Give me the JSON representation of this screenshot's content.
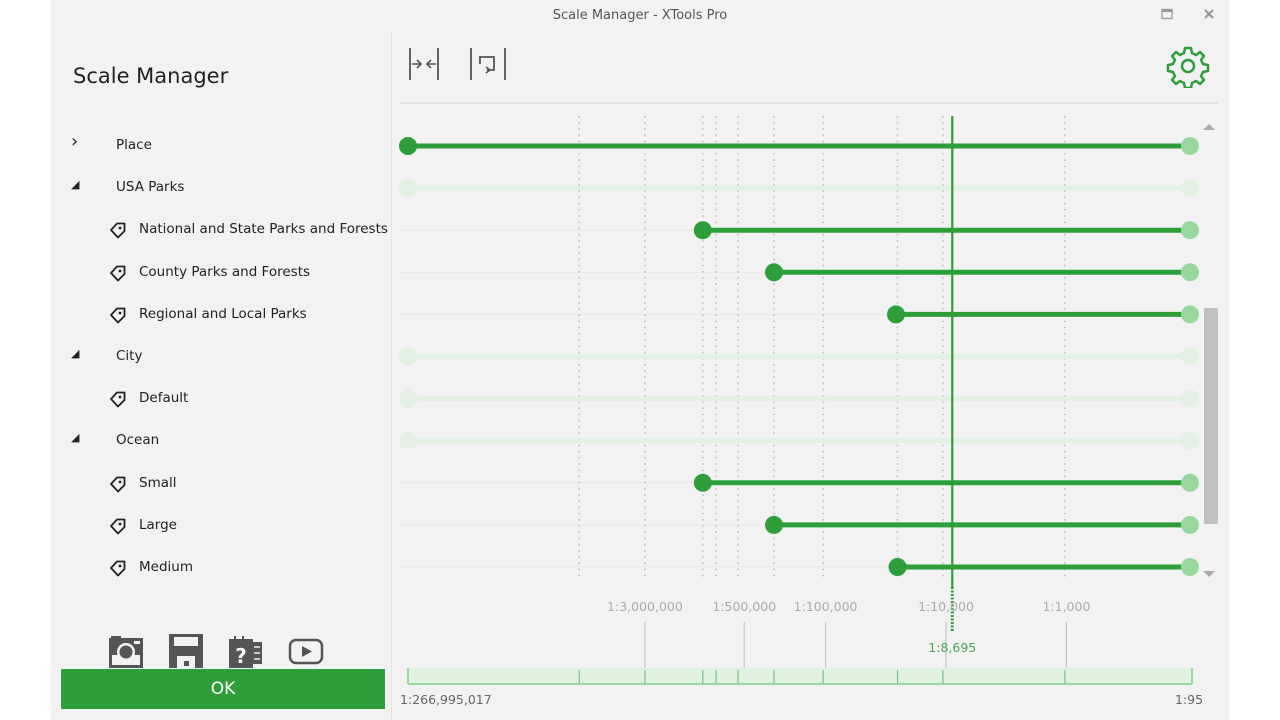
{
  "window": {
    "title": "Scale Manager  -  XTools Pro",
    "maximize_icon": "maximize-icon",
    "close_icon": "close-icon"
  },
  "sidebar": {
    "title": "Scale Manager",
    "tree": [
      {
        "label": "Place",
        "type": "group",
        "expanded": false,
        "active": true,
        "min_scale": "1:266,995,017",
        "max_scale": "1:95"
      },
      {
        "label": "USA Parks",
        "type": "group",
        "expanded": true,
        "active": false
      },
      {
        "label": "National and State Parks and Forests",
        "type": "label-class",
        "active": true,
        "min_scale": "1:1,000,000"
      },
      {
        "label": "County Parks and Forests",
        "type": "label-class",
        "active": true,
        "min_scale": "1:250,000"
      },
      {
        "label": "Regional and Local Parks",
        "type": "label-class",
        "active": true,
        "min_scale": "1:25,000"
      },
      {
        "label": "City",
        "type": "group",
        "expanded": true,
        "active": false
      },
      {
        "label": "Default",
        "type": "label-class",
        "active": false
      },
      {
        "label": "Ocean",
        "type": "group",
        "expanded": true,
        "active": false
      },
      {
        "label": "Small",
        "type": "label-class",
        "active": true,
        "min_scale": "1:1,000,000"
      },
      {
        "label": "Large",
        "type": "label-class",
        "active": true,
        "min_scale": "1:250,000"
      },
      {
        "label": "Medium",
        "type": "label-class",
        "active": true,
        "min_scale": "1:25,000"
      }
    ],
    "tools": [
      {
        "name": "screenshot",
        "icon": "camera-icon"
      },
      {
        "name": "save",
        "icon": "save-icon"
      },
      {
        "name": "help",
        "icon": "help-notebook-icon"
      },
      {
        "name": "video",
        "icon": "video-play-icon"
      }
    ],
    "ok_label": "OK"
  },
  "toolbar": {
    "fit_icon": "fit-width-icon",
    "reset_icon": "reset-range-icon",
    "settings_icon": "gear-icon"
  },
  "scale_axis": {
    "labels": [
      {
        "text": "1:3,000,000",
        "pos": 0.303
      },
      {
        "text": "1:500,000",
        "pos": 0.43
      },
      {
        "text": "1:100,000",
        "pos": 0.534
      },
      {
        "text": "1:10,000",
        "pos": 0.688
      },
      {
        "text": "1:1,000",
        "pos": 0.842
      }
    ],
    "grid_positions": [
      0.219,
      0.303,
      0.377,
      0.394,
      0.422,
      0.468,
      0.531,
      0.626,
      0.684,
      0.84
    ],
    "current_scale": "1:8,695",
    "current_pos": 0.696,
    "min_scale": "1:266,995,017",
    "max_scale": "1:95",
    "row_starts": [
      0.0,
      0.0,
      0.377,
      0.468,
      0.624,
      0.0,
      0.0,
      0.0,
      0.377,
      0.468,
      0.626
    ]
  },
  "colors": {
    "accent": "#2e9e3a",
    "accent_light": "#98d89e",
    "inactive": "#e3f1e4",
    "range_bg": "#dff1df"
  }
}
